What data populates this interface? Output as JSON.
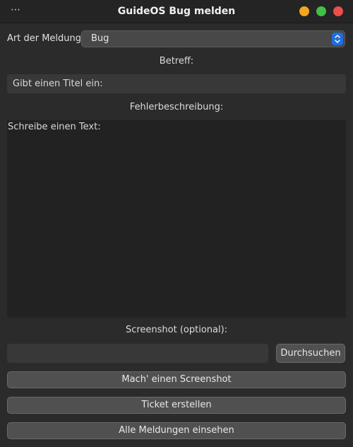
{
  "window": {
    "title": "GuideOS Bug melden",
    "menu_icon": "⋯",
    "controls": {
      "minimize_color": "#f2a81b",
      "maximize_color": "#3fc147",
      "close_color": "#ef4c4c"
    }
  },
  "form": {
    "type_label": "Art der Meldung:",
    "type_selected": "Bug",
    "subject_label": "Betreff:",
    "subject_placeholder": "Gibt einen Titel ein:",
    "description_label": "Fehlerbeschreibung:",
    "description_placeholder": "Schreibe einen Text:",
    "screenshot_label": "Screenshot (optional):",
    "screenshot_path": "",
    "browse_button": "Durchsuchen"
  },
  "actions": {
    "take_screenshot": "Mach' einen Screenshot",
    "create_ticket": "Ticket erstellen",
    "view_all": "Alle Meldungen einsehen"
  },
  "colors": {
    "accent": "#1f6ee0",
    "background": "#2b2b2b"
  }
}
